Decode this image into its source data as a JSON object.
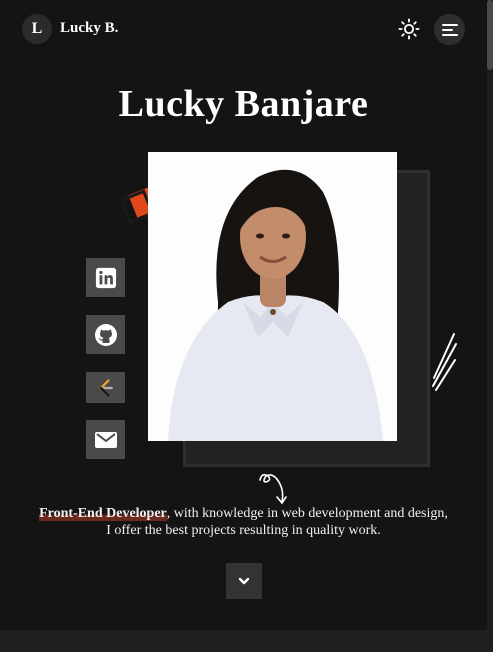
{
  "header": {
    "logo_initial": "L",
    "logo_name": "Lucky B.",
    "theme_toggle_icon": "sun-icon",
    "menu_icon": "hamburger-menu-icon"
  },
  "hero": {
    "title": "Lucky Banjare",
    "photo_alt": "Lucky Banjare portrait",
    "tagline_highlight": "Front-End Developer",
    "tagline_rest_line1": ", with knowledge in web development and design,",
    "tagline_line2": "I offer the best projects resulting in quality work."
  },
  "social": [
    {
      "name": "linkedin",
      "icon": "linkedin-icon"
    },
    {
      "name": "github",
      "icon": "github-icon"
    },
    {
      "name": "leetcode",
      "icon": "leetcode-icon"
    },
    {
      "name": "email",
      "icon": "mail-icon"
    }
  ],
  "scroll_down_icon": "chevron-down-icon",
  "colors": {
    "background": "#141414",
    "accent": "#e0481b",
    "highlight": "#6a2a1e",
    "button": "#4a4a4a"
  }
}
